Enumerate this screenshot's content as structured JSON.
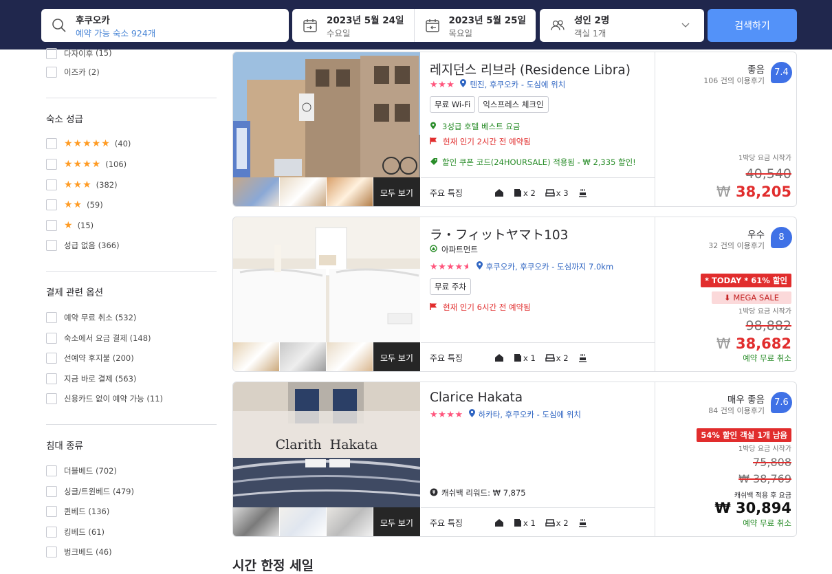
{
  "search": {
    "destination": "후쿠오카",
    "destination_sub": "예약 가능 숙소 924개",
    "checkin_date": "2023년 5월 24일",
    "checkin_day": "수요일",
    "checkout_date": "2023년 5월 25일",
    "checkout_day": "목요일",
    "guests": "성인 2명",
    "rooms": "객실 1개",
    "button": "검색하기"
  },
  "sidebar": {
    "top_items": [
      {
        "label": "다자이후",
        "count": "(15)"
      },
      {
        "label": "이즈카",
        "count": "(2)"
      }
    ],
    "star_title": "숙소 성급",
    "star_items": [
      {
        "stars": "★★★★★",
        "count": "(40)"
      },
      {
        "stars": "★★★★",
        "count": "(106)"
      },
      {
        "stars": "★★★",
        "count": "(382)"
      },
      {
        "stars": "★★",
        "count": "(59)"
      },
      {
        "stars": "★",
        "count": "(15)"
      },
      {
        "label": "성급 없음",
        "count": "(366)"
      }
    ],
    "payment_title": "결제 관련 옵션",
    "payment_items": [
      {
        "label": "예약 무료 취소",
        "count": "(532)"
      },
      {
        "label": "숙소에서 요금 결제",
        "count": "(148)"
      },
      {
        "label": "선예약 후지불",
        "count": "(200)"
      },
      {
        "label": "지금 바로 결제",
        "count": "(563)"
      },
      {
        "label": "신용카드 없이 예약 가능",
        "count": "(11)"
      }
    ],
    "bed_title": "침대 종류",
    "bed_items": [
      {
        "label": "더블베드",
        "count": "(702)"
      },
      {
        "label": "싱글/트윈베드",
        "count": "(479)"
      },
      {
        "label": "퀸베드",
        "count": "(136)"
      },
      {
        "label": "킹베드",
        "count": "(61)"
      },
      {
        "label": "벙크베드",
        "count": "(46)"
      }
    ]
  },
  "cards": [
    {
      "name": "레지던스 리브라 (Residence Libra)",
      "stars": "★★★",
      "location": "텐진, 후쿠오카 - 도심에 위치",
      "tags": [
        "무료 Wi-Fi",
        "익스프레스 체크인"
      ],
      "line1": "3성급 호텔 베스트 요금",
      "line2": "현재 인기 2시간 전 예약됨",
      "line3": "할인 쿠폰 코드(24HOURSALE) 적용됨 - ₩ 2,335 할인!",
      "view_all": "모두 보기",
      "features_label": "주요 특징",
      "feat_a": "x 2",
      "feat_b": "x 3",
      "rating_word": "좋음",
      "review_count": "106 건의 이용후기",
      "score": "7.4",
      "per_night": "1박당 요금 시작가",
      "old_price": "40,540",
      "currency": "₩",
      "price": "38,205"
    },
    {
      "name": "ラ・フィットヤマト103",
      "type": "아파트먼트",
      "stars": "★★★★",
      "half_star": "★",
      "location": "후쿠오카, 후쿠오카 - 도심까지 7.0km",
      "tags": [
        "무료 주차"
      ],
      "line2": "현재 인기 6시간 전 예약됨",
      "view_all": "모두 보기",
      "features_label": "주요 특징",
      "feat_a": "x 1",
      "feat_b": "x 2",
      "rating_word": "우수",
      "review_count": "32 건의 이용후기",
      "score": "8",
      "today_badge": "* TODAY * 61% 할인",
      "mega_sale": "MEGA SALE",
      "per_night": "1박당 요금 시작가",
      "old_price": "98,882",
      "currency": "₩",
      "price": "38,682",
      "free_cancel": "예약 무료 취소"
    },
    {
      "name": "Clarice Hakata",
      "stars": "★★★★",
      "location": "하카타, 후쿠오카 - 도심에 위치",
      "photo_text": "Clarith  Hakata",
      "cashback": "캐쉬백 리워드: ₩ 7,875",
      "view_all": "모두 보기",
      "features_label": "주요 특징",
      "feat_a": "x 1",
      "feat_b": "x 2",
      "rating_word": "매우 좋음",
      "review_count": "84 건의 이용후기",
      "score": "7.6",
      "discount_badge": "54% 할인 객실 1개 남음",
      "per_night": "1박당 요금 시작가",
      "old_price": "75,808",
      "mid_price": "₩ 38,769",
      "cashback_note": "캐쉬백 적용 후 요금",
      "currency": "₩",
      "price": "30,894",
      "free_cancel": "예약 무료 취소"
    }
  ],
  "section_title": "시간 한정 세일"
}
